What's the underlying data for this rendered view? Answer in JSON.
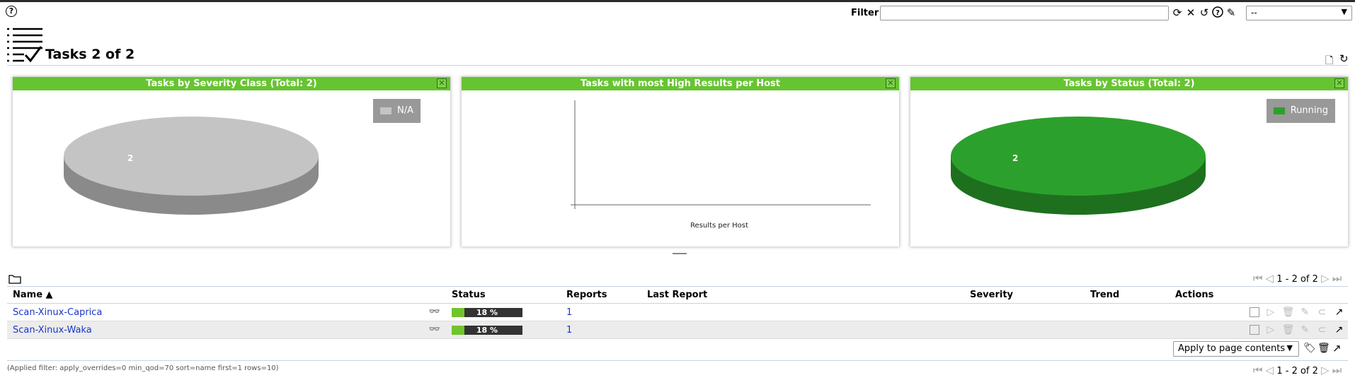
{
  "toolbar": {
    "filter_label": "Filter",
    "filter_value": "",
    "filter_select_value": "--",
    "icons": [
      "refresh-icon",
      "clear-icon",
      "reset-icon",
      "help-icon",
      "edit-icon"
    ]
  },
  "page": {
    "title": "Tasks 2 of 2"
  },
  "panels": [
    {
      "title": "Tasks by Severity Class (Total: 2)",
      "legend": "N/A",
      "legend_color": "#c4c4c4",
      "slice_label": "2",
      "slice_top": "#c4c4c4",
      "slice_side": "#8a8a8a"
    },
    {
      "title": "Tasks with most High Results per Host",
      "xlabel": "Results per Host"
    },
    {
      "title": "Tasks by Status (Total: 2)",
      "legend": "Running",
      "legend_color": "#2ca02c",
      "slice_label": "2",
      "slice_top": "#2ca02c",
      "slice_side": "#1e701e"
    }
  ],
  "pager_top": "1 - 2 of 2",
  "pager_bottom": "1 - 2 of 2",
  "table": {
    "headers": {
      "name": "Name ▲",
      "status": "Status",
      "reports": "Reports",
      "last_report": "Last Report",
      "severity": "Severity",
      "trend": "Trend",
      "actions": "Actions"
    },
    "rows": [
      {
        "name": "Scan-Xinux-Caprica",
        "progress": 18,
        "progress_text": "18 %",
        "reports": "1",
        "last_report": "",
        "severity": "",
        "trend": ""
      },
      {
        "name": "Scan-Xinux-Waka",
        "progress": 18,
        "progress_text": "18 %",
        "reports": "1",
        "last_report": "",
        "severity": "",
        "trend": ""
      }
    ]
  },
  "bulk": {
    "apply_label": "Apply to page contents"
  },
  "applied_filter": "(Applied filter: apply_overrides=0 min_qod=70 sort=name first=1 rows=10)",
  "colors": {
    "accent_green": "#66c430",
    "link_blue": "#1a35c8"
  }
}
